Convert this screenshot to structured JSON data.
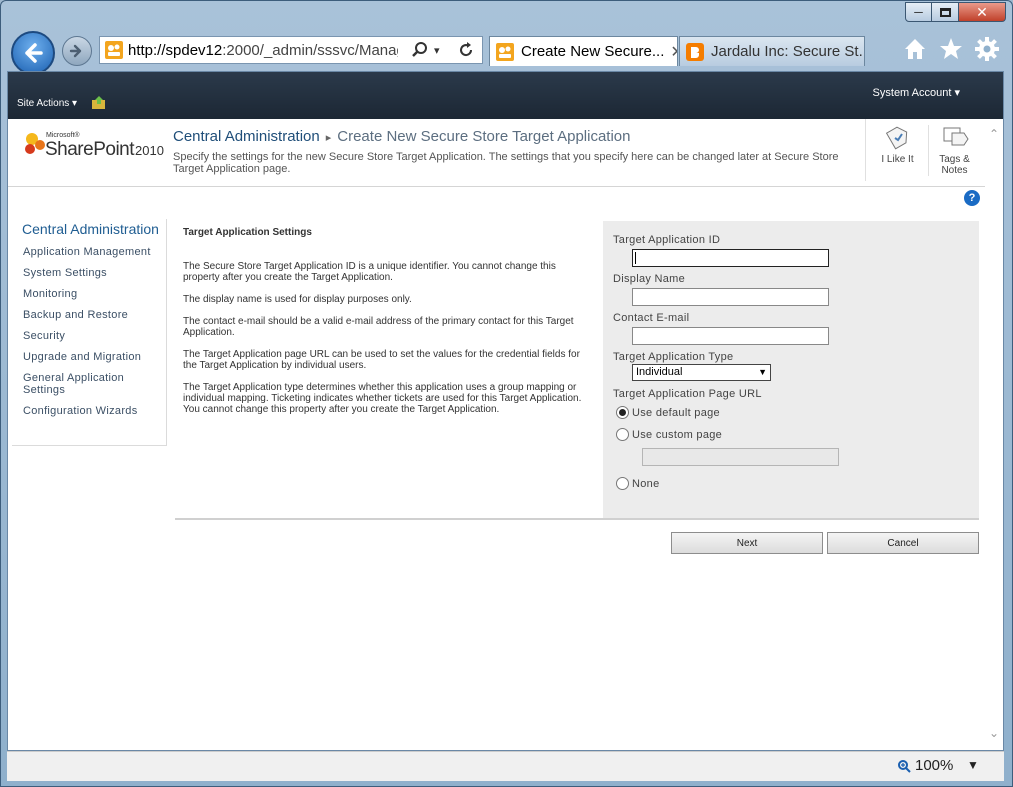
{
  "browser": {
    "address_host": "http://spdev12",
    "address_rest": ":2000/_admin/sssvc/Manag",
    "tabs": [
      {
        "label": "Create New Secure...",
        "active": true
      },
      {
        "label": "Jardalu Inc: Secure St...",
        "active": false
      }
    ],
    "zoom": "100%"
  },
  "ribbon": {
    "site_actions": "Site Actions",
    "account": "System Account"
  },
  "header": {
    "logo_microsoft": "Microsoft®",
    "logo_product": "SharePoint",
    "logo_year": "2010",
    "breadcrumb_root": "Central Administration",
    "breadcrumb_page": "Create New Secure Store Target Application",
    "description": "Specify the settings for the new Secure Store Target Application. The settings that you specify here can be changed later at Secure Store Target Application page.",
    "like_label": "I Like It",
    "tags_label": "Tags & Notes"
  },
  "quicklaunch": {
    "heading": "Central Administration",
    "items": [
      "Application Management",
      "System Settings",
      "Monitoring",
      "Backup and Restore",
      "Security",
      "Upgrade and Migration",
      "General Application Settings",
      "Configuration Wizards"
    ]
  },
  "section": {
    "title": "Target Application Settings",
    "paragraphs": [
      "The Secure Store Target Application ID is a unique identifier. You cannot change this property after you create the Target Application.",
      "The display name is used for display purposes only.",
      "The contact e-mail should be a valid e-mail address of the primary contact for this Target Application.",
      "The Target Application page URL can be used to set the values for the credential fields for the Target Application by individual users.",
      "The Target Application type determines whether this application uses a group mapping or individual mapping. Ticketing indicates whether tickets are used for this Target Application. You cannot change this property after you create the Target Application."
    ]
  },
  "form": {
    "id_label": "Target Application ID",
    "id_value": "",
    "name_label": "Display Name",
    "name_value": "",
    "email_label": "Contact E-mail",
    "email_value": "",
    "type_label": "Target Application Type",
    "type_value": "Individual",
    "url_label": "Target Application Page URL",
    "url_options": [
      "Use default page",
      "Use custom page",
      "None"
    ],
    "url_selected": "Use default page",
    "custom_url_value": ""
  },
  "buttons": {
    "next": "Next",
    "cancel": "Cancel"
  }
}
